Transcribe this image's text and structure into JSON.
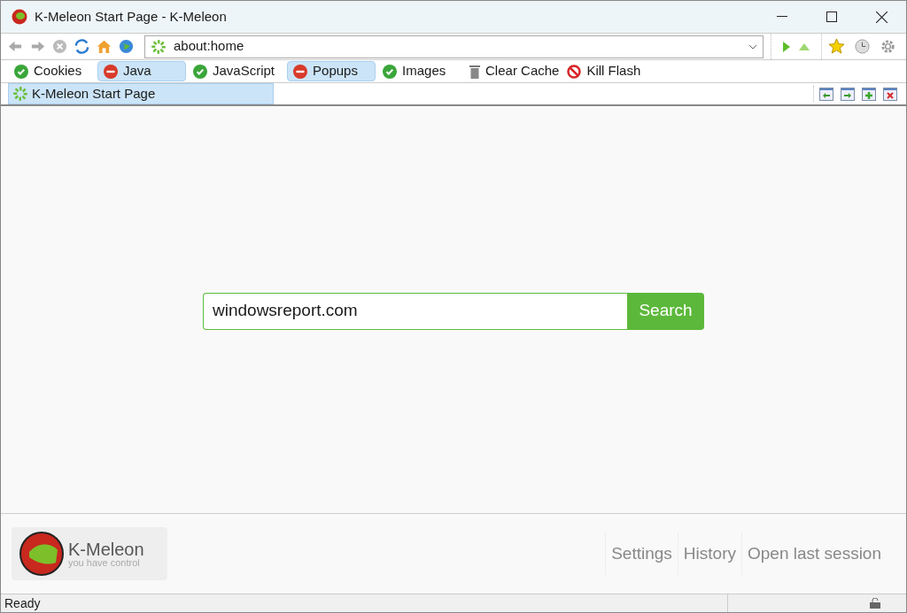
{
  "window": {
    "title": "K-Meleon Start Page - K-Meleon"
  },
  "address": {
    "value": "about:home"
  },
  "privacy_bar": [
    {
      "kind": "toggle",
      "label": "Cookies",
      "on": true
    },
    {
      "kind": "toggle",
      "label": "Java",
      "on": false
    },
    {
      "kind": "toggle",
      "label": "JavaScript",
      "on": true
    },
    {
      "kind": "toggle",
      "label": "Popups",
      "on": false
    },
    {
      "kind": "toggle",
      "label": "Images",
      "on": true
    },
    {
      "kind": "clear",
      "label": "Clear Cache"
    },
    {
      "kind": "kill",
      "label": "Kill Flash"
    }
  ],
  "tabs": [
    {
      "label": "K-Meleon Start Page",
      "selected": true
    }
  ],
  "search": {
    "value": "windowsreport.com",
    "button": "Search"
  },
  "logo": {
    "name": "K-Meleon",
    "tagline": "you have control"
  },
  "footer_links": [
    "Settings",
    "History",
    "Open last session"
  ],
  "status_bar": {
    "text": "Ready"
  }
}
